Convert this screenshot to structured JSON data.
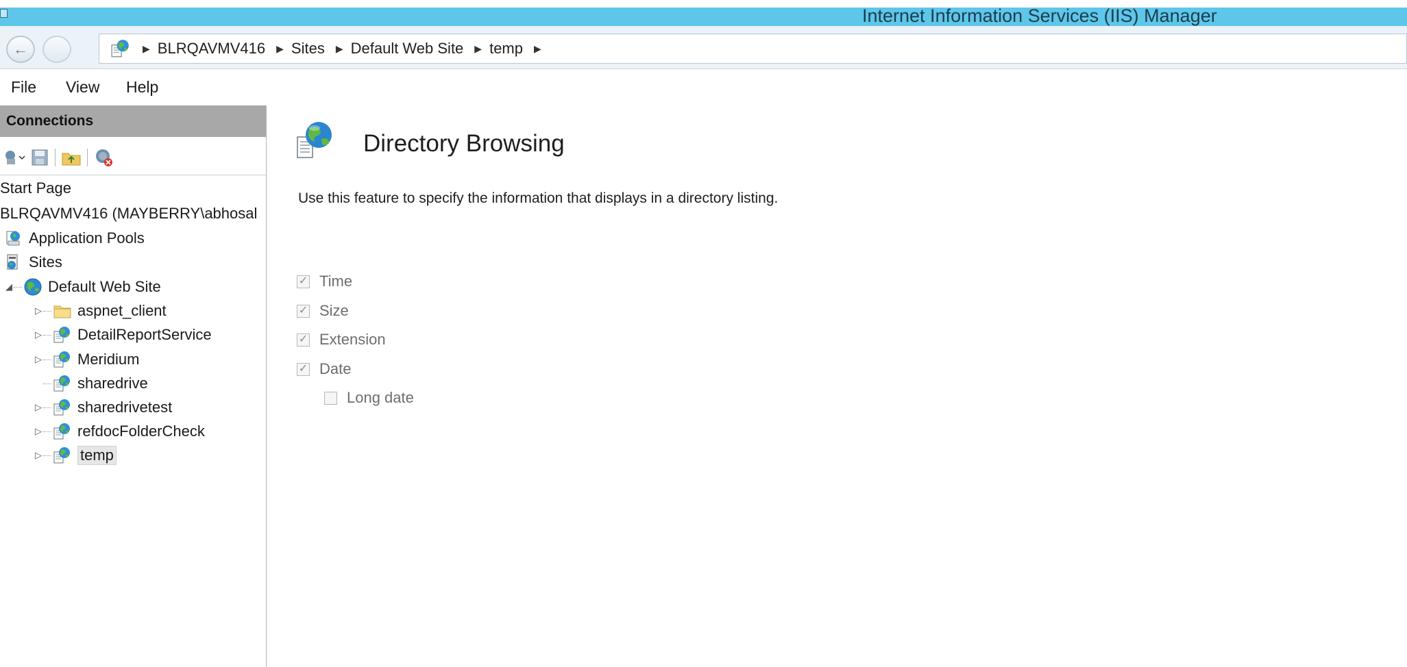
{
  "window": {
    "title": "Internet Information Services (IIS) Manager"
  },
  "address_bar": {
    "breadcrumb": [
      "BLRQAVMV416",
      "Sites",
      "Default Web Site",
      "temp"
    ]
  },
  "menu": {
    "file": "File",
    "view": "View",
    "help": "Help"
  },
  "connections": {
    "header": "Connections",
    "toolbar_icons": [
      "connect-icon",
      "save-icon",
      "up-folder-icon",
      "disconnect-icon"
    ],
    "tree": {
      "start_page": "Start Page",
      "server": "BLRQAVMV416 (MAYBERRY\\abhosal",
      "app_pools": "Application Pools",
      "sites": "Sites",
      "default_web_site": "Default Web Site",
      "children": [
        {
          "label": "aspnet_client",
          "icon": "folder-icon",
          "expandable": true
        },
        {
          "label": "DetailReportService",
          "icon": "web-app-icon",
          "expandable": true
        },
        {
          "label": "Meridium",
          "icon": "web-app-icon",
          "expandable": true
        },
        {
          "label": "sharedrive",
          "icon": "web-app-icon",
          "expandable": false
        },
        {
          "label": "sharedrivetest",
          "icon": "web-app-icon",
          "expandable": true
        },
        {
          "label": "refdocFolderCheck",
          "icon": "web-app-icon",
          "expandable": true
        },
        {
          "label": "temp",
          "icon": "web-app-icon",
          "expandable": true,
          "selected": true
        }
      ]
    }
  },
  "content": {
    "title": "Directory Browsing",
    "description": "Use this feature to specify the information that displays in a directory listing.",
    "options": {
      "time": {
        "label": "Time",
        "checked": true
      },
      "size": {
        "label": "Size",
        "checked": true
      },
      "extension": {
        "label": "Extension",
        "checked": true
      },
      "date": {
        "label": "Date",
        "checked": true
      },
      "long_date": {
        "label": "Long date",
        "checked": false
      }
    }
  },
  "colors": {
    "titlebar": "#5ec6e9",
    "connections_header": "#a8a8a8",
    "address_bar": "#ebf3f9"
  }
}
